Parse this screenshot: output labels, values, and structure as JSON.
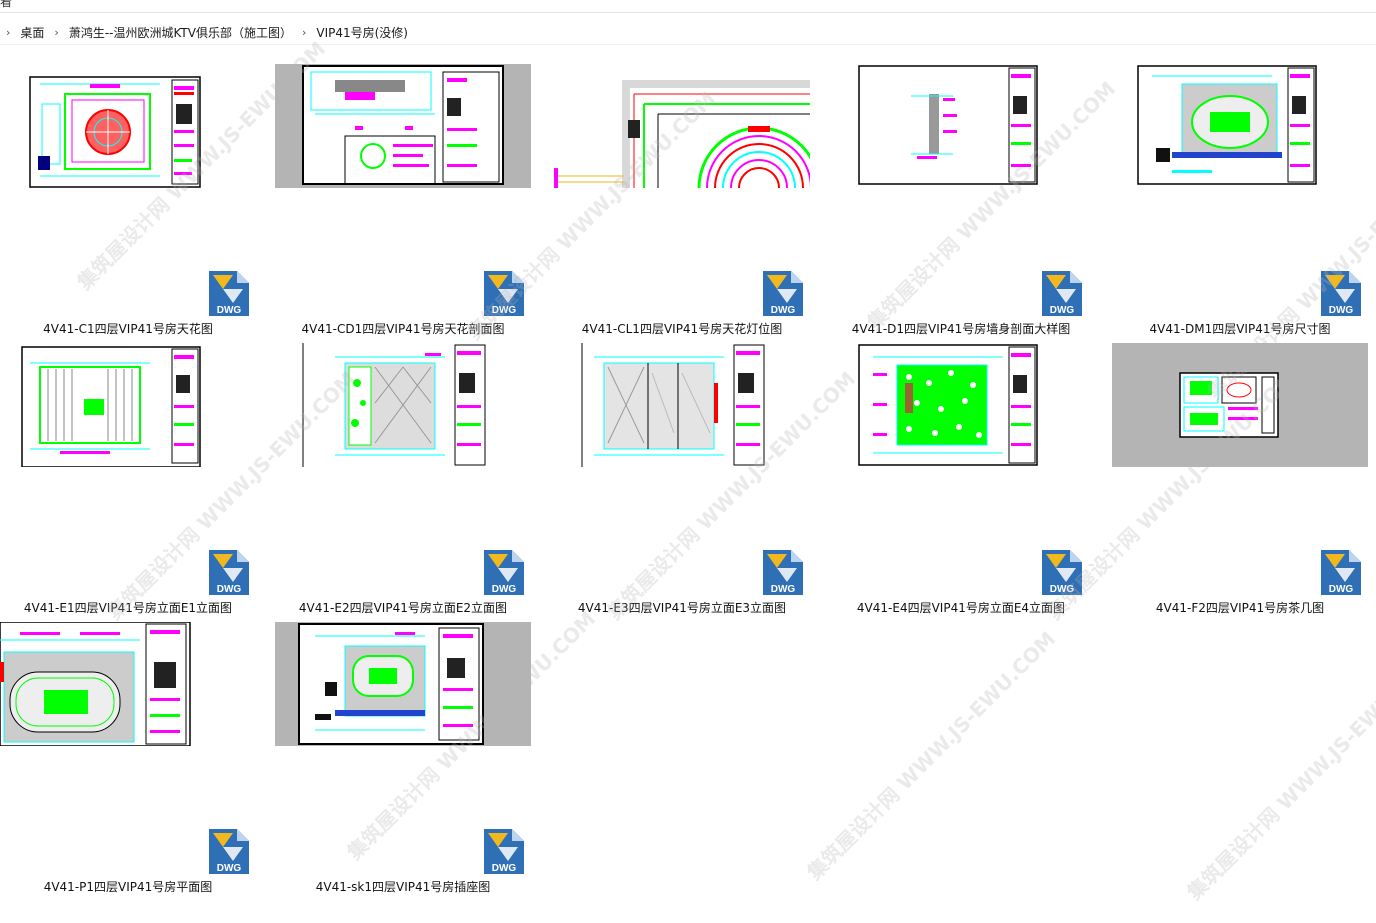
{
  "window": {
    "title_fragment": "看"
  },
  "breadcrumb": [
    "桌面",
    "萧鸿生--温州欧洲城KTV俱乐部（施工图）",
    "VIP41号房(没修)"
  ],
  "file_type_badge": "DWG",
  "files": [
    {
      "name": "4V41-C1四层VIP41号房天花图",
      "thumb": "sheet-circle"
    },
    {
      "name": "4V41-CD1四层VIP41号房天花剖面图",
      "thumb": "gray-section"
    },
    {
      "name": "4V41-CL1四层VIP41号房天花灯位图",
      "thumb": "zoom-circle"
    },
    {
      "name": "4V41-D1四层VIP41号房墙身剖面大样图",
      "thumb": "sheet-detail"
    },
    {
      "name": "4V41-DM1四层VIP41号房尺寸图",
      "thumb": "sheet-plan"
    },
    {
      "name": "4V41-E1四层VIP41号房立面E1立面图",
      "thumb": "sheet-elev-a"
    },
    {
      "name": "4V41-E2四层VIP41号房立面E2立面图",
      "thumb": "sheet-elev-b"
    },
    {
      "name": "4V41-E3四层VIP41号房立面E3立面图",
      "thumb": "sheet-elev-c"
    },
    {
      "name": "4V41-E4四层VIP41号房立面E4立面图",
      "thumb": "sheet-elev-d"
    },
    {
      "name": "4V41-F2四层VIP41号房茶几图",
      "thumb": "gray-small"
    },
    {
      "name": "4V41-P1四层VIP41号房平面图",
      "thumb": "sheet-floor"
    },
    {
      "name": "4V41-sk1四层VIP41号房插座图",
      "thumb": "gray-socket"
    }
  ],
  "watermark_text": "集筑屋设计网 WWW.JS-EWU.COM",
  "colors": {
    "dwg_blue": "#2f6fb5",
    "dwg_yellow": "#f2b91e",
    "cad_green": "#00ff00",
    "cad_magenta": "#ff00ff",
    "cad_cyan": "#00ffff",
    "cad_red": "#ff0000",
    "gray_bg": "#b4b4b4"
  }
}
